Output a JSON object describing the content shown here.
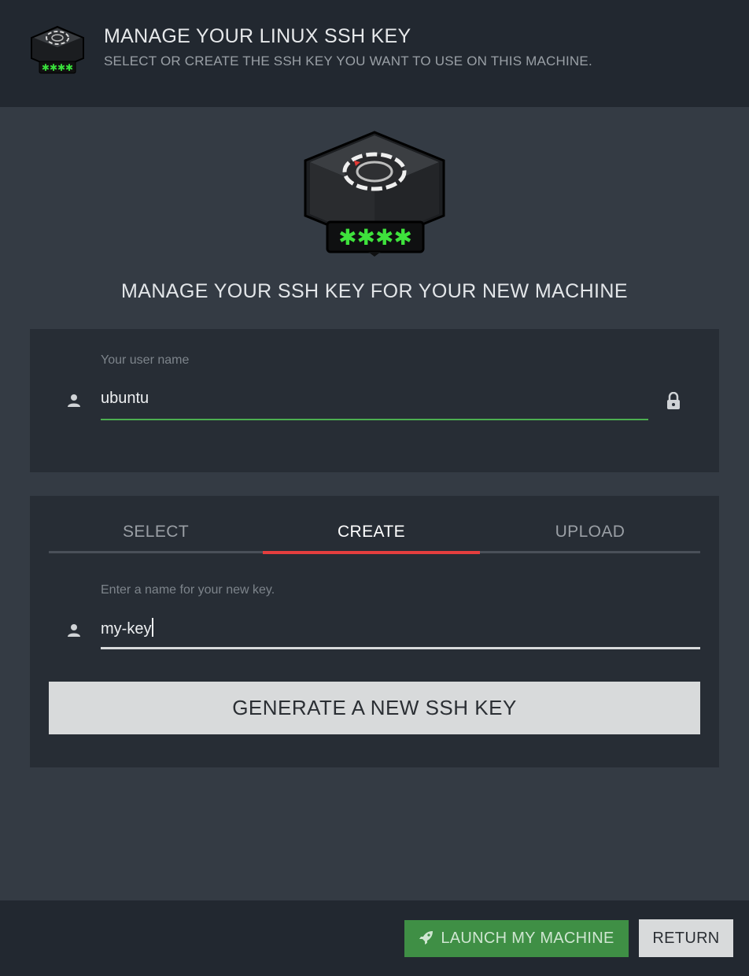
{
  "header": {
    "title": "MANAGE YOUR LINUX SSH KEY",
    "subtitle": "SELECT OR CREATE THE SSH KEY YOU WANT TO USE ON THIS MACHINE.",
    "logo_icon": "ssh-key-device-icon"
  },
  "main": {
    "hero_icon": "ssh-key-device-icon",
    "title": "MANAGE YOUR SSH KEY FOR YOUR NEW MACHINE"
  },
  "user_card": {
    "label": "Your user name",
    "value": "ubuntu",
    "icons": [
      "person-icon",
      "lock-icon"
    ],
    "underline_color": "#4caf50"
  },
  "key_card": {
    "tabs": [
      {
        "label": "SELECT",
        "active": false
      },
      {
        "label": "CREATE",
        "active": true
      },
      {
        "label": "UPLOAD",
        "active": false
      }
    ],
    "active_tab_color": "#e53e3e",
    "name_field": {
      "label": "Enter a name for your new key.",
      "value": "my-key"
    },
    "generate_button": "GENERATE A NEW SSH KEY"
  },
  "footer": {
    "launch_button": "LAUNCH MY MACHINE",
    "launch_icon": "rocket-icon",
    "launch_color": "#3f8f45",
    "return_button": "RETURN"
  }
}
